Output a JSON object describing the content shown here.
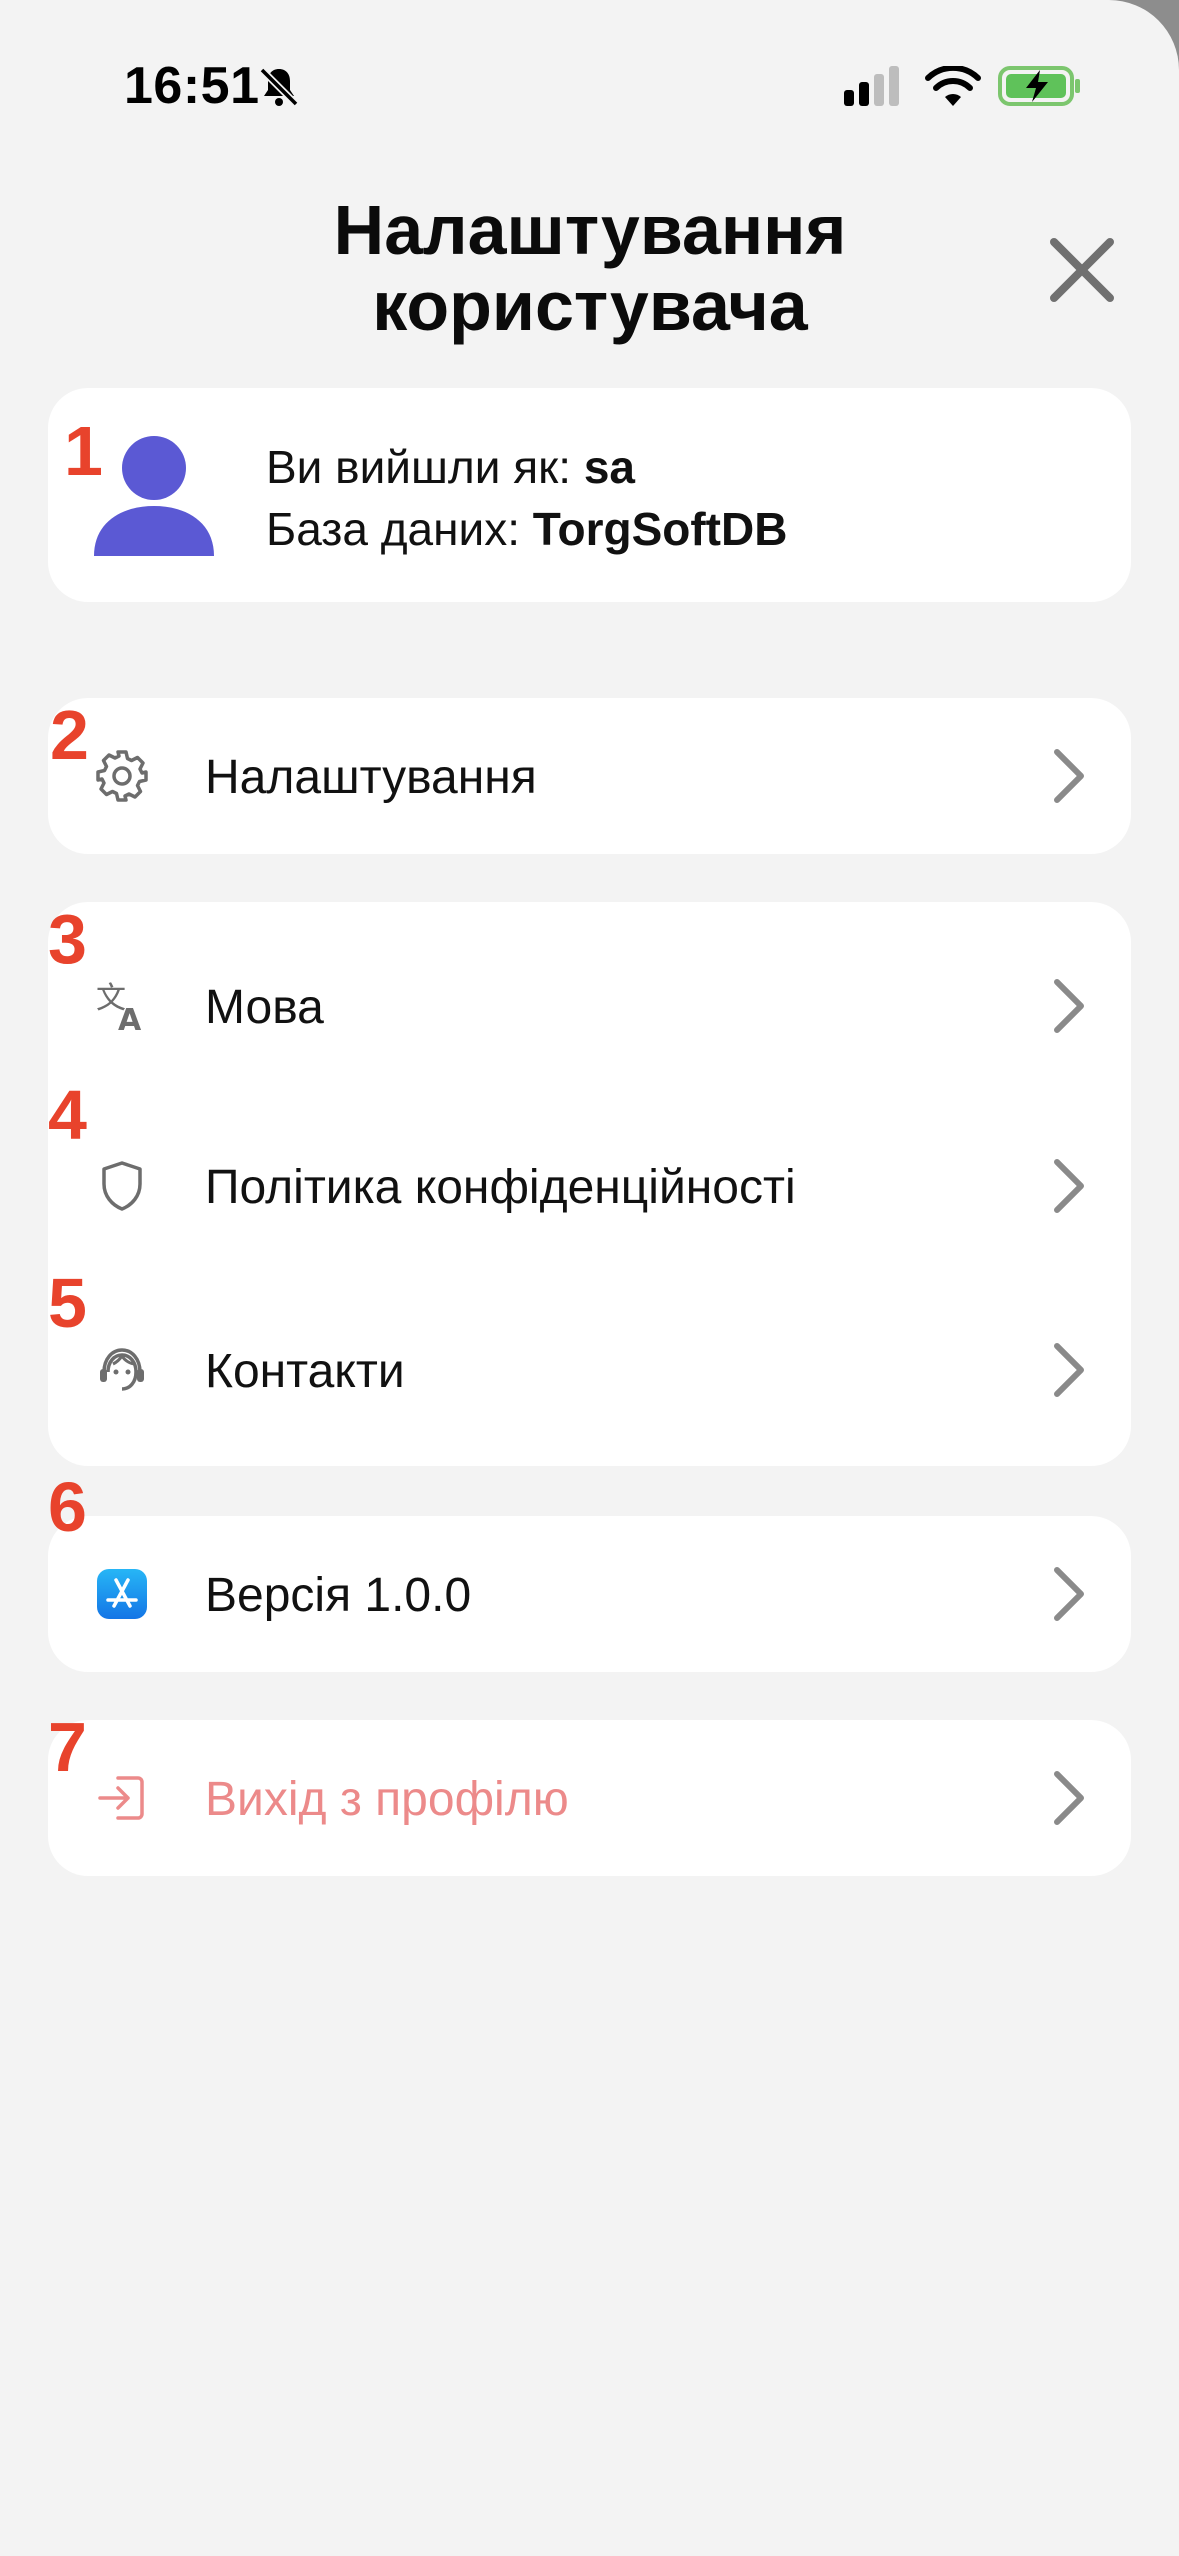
{
  "status_bar": {
    "time": "16:51",
    "icons": [
      "bell-slash-icon",
      "cellular-signal-icon",
      "wifi-icon",
      "battery-charging-icon"
    ]
  },
  "header": {
    "title": "Налаштування користувача",
    "close_icon": "close-icon"
  },
  "profile": {
    "number": "1",
    "login_label": "Ви вийшли як:",
    "login_value": "sa",
    "db_label": "База даних:",
    "db_value": "TorgSoftDB",
    "avatar_color": "#5b59d4"
  },
  "menu": [
    {
      "number": "2",
      "label": "Налаштування",
      "icon": "gear-icon"
    },
    {
      "number": "3",
      "label": "Мова",
      "icon": "translate-icon"
    },
    {
      "number": "4",
      "label": "Політика конфіденційності",
      "icon": "shield-icon"
    },
    {
      "number": "5",
      "label": "Контакти",
      "icon": "support-agent-icon"
    },
    {
      "number": "6",
      "label": "Версія 1.0.0",
      "icon": "app-store-icon"
    },
    {
      "number": "7",
      "label": "Вихід з профілю",
      "icon": "logout-icon"
    }
  ],
  "colors": {
    "accent": "#5b59d4",
    "annotation_number": "#e8432c",
    "logout_text": "#ec8a8a",
    "chevron": "#8a8a8a",
    "background": "#f3f3f3",
    "card": "#ffffff"
  }
}
